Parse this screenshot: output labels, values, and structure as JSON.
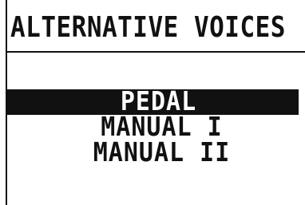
{
  "screen": {
    "title": "ALTERNATIVE VOICES"
  },
  "menu": {
    "items": [
      {
        "label": "PEDAL",
        "selected": true
      },
      {
        "label": "MANUAL I",
        "selected": false
      },
      {
        "label": "MANUAL II",
        "selected": false
      }
    ]
  },
  "colors": {
    "background": "#ffffff",
    "foreground": "#111111",
    "highlight": "#111111",
    "highlight_text": "#ffffff"
  }
}
